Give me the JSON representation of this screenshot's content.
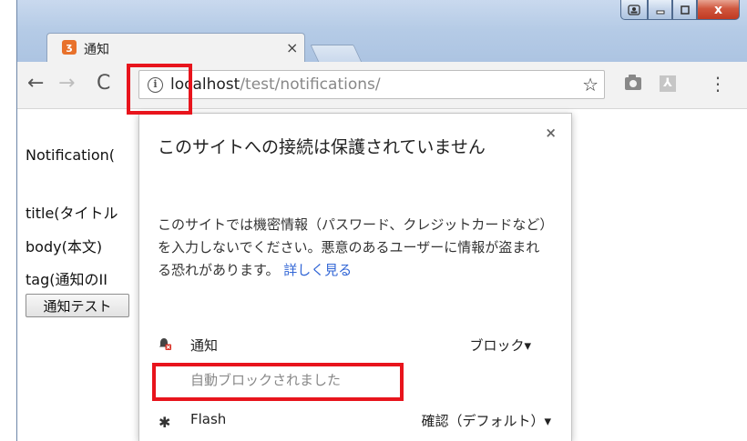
{
  "tab": {
    "title": "通知",
    "close": "×",
    "favicon": "xampp-icon"
  },
  "window": {
    "close_glyph": "x"
  },
  "omnibox": {
    "host": "localhost",
    "path": "/test/notifications/",
    "star": "☆"
  },
  "page": {
    "line1": "Notification(",
    "line2": "title(タイトル",
    "line3": "body(本文)",
    "line4": "tag(通知のII",
    "button": "通知テスト"
  },
  "bubble": {
    "close": "×",
    "heading": "このサイトへの接続は保護されていません",
    "description": "このサイトでは機密情報（パスワード、クレジットカードなど）を入力しないでください。悪意のあるユーザーに情報が盗まれる恐れがあります。",
    "link": "詳しく見る",
    "permissions": [
      {
        "label": "通知",
        "value": "ブロック▾",
        "sub": "自動ブロックされました",
        "icon": "bell-blocked-icon"
      },
      {
        "label": "Flash",
        "value": "確認（デフォルト）▾",
        "icon": "puzzle-icon"
      }
    ]
  },
  "colors": {
    "highlight": "#e8141c",
    "link": "#3367d6"
  }
}
